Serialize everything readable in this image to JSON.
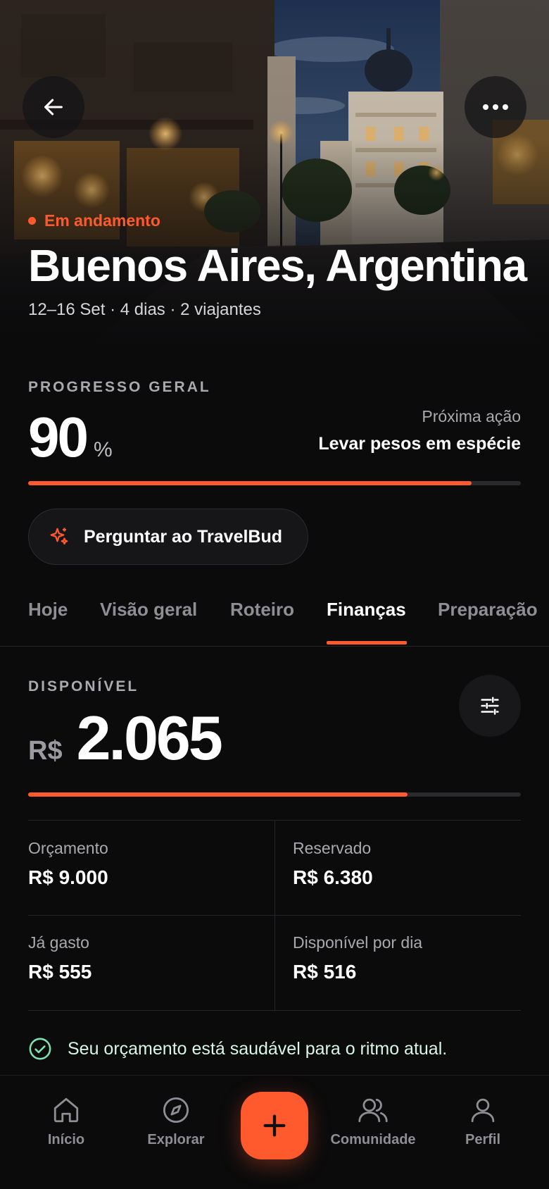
{
  "trip": {
    "status": "Em andamento",
    "title": "Buenos Aires, Argentina",
    "subtitle": "12–16 Set · 4 dias · 2 viajantes"
  },
  "progress": {
    "label": "PROGRESSO GERAL",
    "value": "90",
    "unit": "%",
    "fraction": 0.9,
    "next_action_label": "Próxima ação",
    "next_action_value": "Levar pesos em espécie"
  },
  "ask_button": {
    "label": "Perguntar ao TravelBud",
    "icon": "sparkles-icon"
  },
  "tabs": [
    {
      "label": "Hoje",
      "active": false
    },
    {
      "label": "Visão geral",
      "active": false
    },
    {
      "label": "Roteiro",
      "active": false
    },
    {
      "label": "Finanças",
      "active": true
    },
    {
      "label": "Preparação",
      "active": false
    }
  ],
  "finance": {
    "available_label": "DISPONÍVEL",
    "currency": "R$",
    "available_value": "2.065",
    "available_fraction": 0.77,
    "cells": [
      {
        "label": "Orçamento",
        "value": "R$ 9.000"
      },
      {
        "label": "Reservado",
        "value": "R$ 6.380"
      },
      {
        "label": "Já gasto",
        "value": "R$ 555"
      },
      {
        "label": "Disponível por dia",
        "value": "R$ 516"
      }
    ],
    "health_message": "Seu orçamento está saudável para o ritmo atual."
  },
  "nav": {
    "items": [
      {
        "label": "Início",
        "icon": "home-icon"
      },
      {
        "label": "Explorar",
        "icon": "compass-icon"
      },
      {
        "label": "Comunidade",
        "icon": "users-icon"
      },
      {
        "label": "Perfil",
        "icon": "user-icon"
      }
    ],
    "fab_icon": "plus-icon"
  },
  "colors": {
    "accent": "#ff5a2e",
    "background": "#0b0b0c",
    "success": "#7fe0b0"
  }
}
